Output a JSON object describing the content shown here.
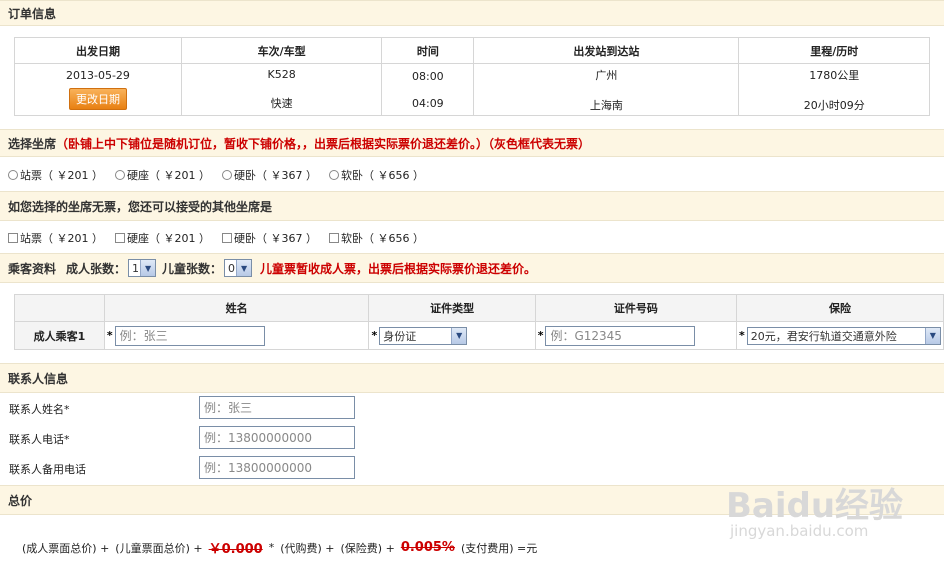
{
  "order_section": {
    "title": "订单信息"
  },
  "trip_table": {
    "headers": [
      "出发日期",
      "车次/车型",
      "时间",
      "出发站到达站",
      "里程/历时"
    ],
    "date": "2013-05-29",
    "change_date_button": "更改日期",
    "train_no": "K528",
    "train_type": "快速",
    "depart_time": "08:00",
    "duration_time": "04:09",
    "from_station": "广州",
    "to_station": "上海南",
    "distance": "1780公里",
    "duration": "20小时09分"
  },
  "seat_section": {
    "title": "选择坐席",
    "note": "（卧铺上中下铺位是随机订位，暂收下铺价格，，出票后根据实际票价退还差价。）（灰色框代表无票）",
    "options": [
      "站票（ ￥201 ）",
      "硬座（ ￥201 ）",
      "硬卧（ ￥367 ）",
      "软卧（ ￥656 ）"
    ]
  },
  "alt_seat_section": {
    "title": "如您选择的坐席无票，您还可以接受的其他坐席是",
    "options": [
      "站票（ ￥201 ）",
      "硬座（ ￥201 ）",
      "硬卧（ ￥367 ）",
      "软卧（ ￥656 ）"
    ]
  },
  "passenger_section": {
    "title": "乘客资料",
    "adult_label": "成人张数：",
    "adult_count": "1",
    "child_label": "儿童张数：",
    "child_count": "0",
    "child_note": "儿童票暂收成人票，出票后根据实际票价退还差价。"
  },
  "passenger_table": {
    "headers": [
      "姓名",
      "证件类型",
      "证件号码",
      "保险"
    ],
    "row_label": "成人乘客1",
    "star": "*",
    "name_placeholder": "例：张三",
    "id_type": "身份证",
    "id_placeholder": "例：G12345",
    "insurance": "20元，君安行轨道交通意外险"
  },
  "contact_section": {
    "title": "联系人信息",
    "name_label": "联系人姓名*",
    "name_placeholder": "例：张三",
    "phone_label": "联系人电话*",
    "phone_placeholder": "例：13800000000",
    "alt_phone_label": "联系人备用电话",
    "alt_phone_placeholder": "例：13800000000"
  },
  "total_section": {
    "title": "总价",
    "part1": "(成人票面总价) +",
    "part2": "(儿童票面总价) +",
    "child_price": "￥0.000",
    "part3": "*",
    "part4": "(代购费) +",
    "part5": "(保险费) +",
    "rate": "0.005%",
    "part6": "(支付费用) =元"
  },
  "watermark": {
    "brand": "Baidu经验",
    "url": "jingyan.baidu.com"
  }
}
